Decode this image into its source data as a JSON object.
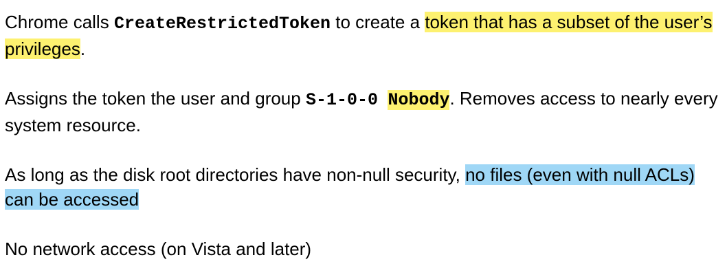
{
  "paragraphs": {
    "p1": {
      "t1": "Chrome calls ",
      "code": "CreateRestrictedToken",
      "t2": " to create a ",
      "highlight": "token that has a subset of the user’s privileges",
      "t3": "."
    },
    "p2": {
      "t1": "Assigns the token the user and group ",
      "code1": "S-1-0-0",
      "code2": "Nobody",
      "t2": ". Removes access to nearly every system resource."
    },
    "p3": {
      "t1": "As long as the disk root directories have non-null security, ",
      "highlight": "no files (even with null ACLs) can be accessed"
    },
    "p4": {
      "t1": "No network access (on Vista and later)"
    }
  },
  "colors": {
    "highlight_yellow": "#fdf170",
    "highlight_blue": "#9fd7f6",
    "text": "#000000",
    "background": "#ffffff"
  }
}
